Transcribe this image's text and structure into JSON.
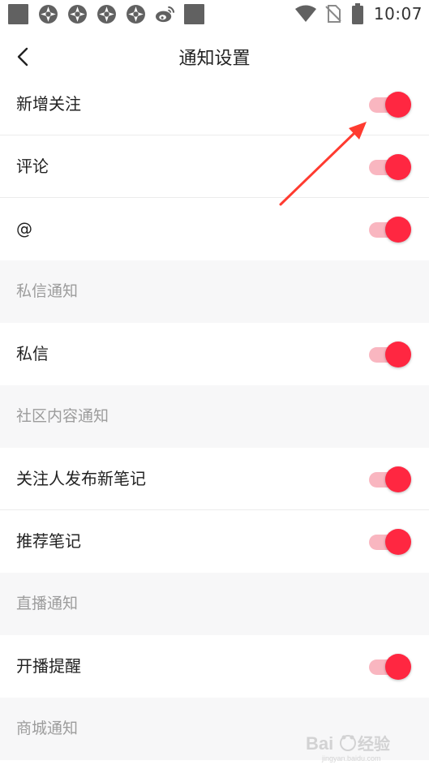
{
  "status_bar": {
    "time": "10:07",
    "icons": [
      "square-notification-icon",
      "aperture-app-icon",
      "aperture-app-icon",
      "aperture-app-icon",
      "aperture-app-icon",
      "weibo-icon",
      "square-notification-icon",
      "wifi-icon",
      "no-sim-icon",
      "battery-icon"
    ]
  },
  "header": {
    "title": "通知设置",
    "back_icon": "chevron-left-icon"
  },
  "rows": [
    {
      "type": "setting",
      "label": "新增关注",
      "on": true
    },
    {
      "type": "setting",
      "label": "评论",
      "on": true
    },
    {
      "type": "setting",
      "label": "@",
      "on": true
    },
    {
      "type": "section",
      "label": "私信通知"
    },
    {
      "type": "setting",
      "label": "私信",
      "on": true
    },
    {
      "type": "section",
      "label": "社区内容通知"
    },
    {
      "type": "setting",
      "label": "关注人发布新笔记",
      "on": true
    },
    {
      "type": "setting",
      "label": "推荐笔记",
      "on": true
    },
    {
      "type": "section",
      "label": "直播通知"
    },
    {
      "type": "setting",
      "label": "开播提醒",
      "on": true
    },
    {
      "type": "section",
      "label": "商城通知"
    }
  ],
  "colors": {
    "switch_thumb": "#ff2741",
    "switch_track": "#f9b6c0",
    "section_bg": "#f7f7f8",
    "annotation_arrow": "#ff3b30"
  },
  "annotation": {
    "icon": "red-arrow-pointer-icon"
  },
  "watermark": {
    "icon": "baidu-jingyan-watermark-icon"
  }
}
